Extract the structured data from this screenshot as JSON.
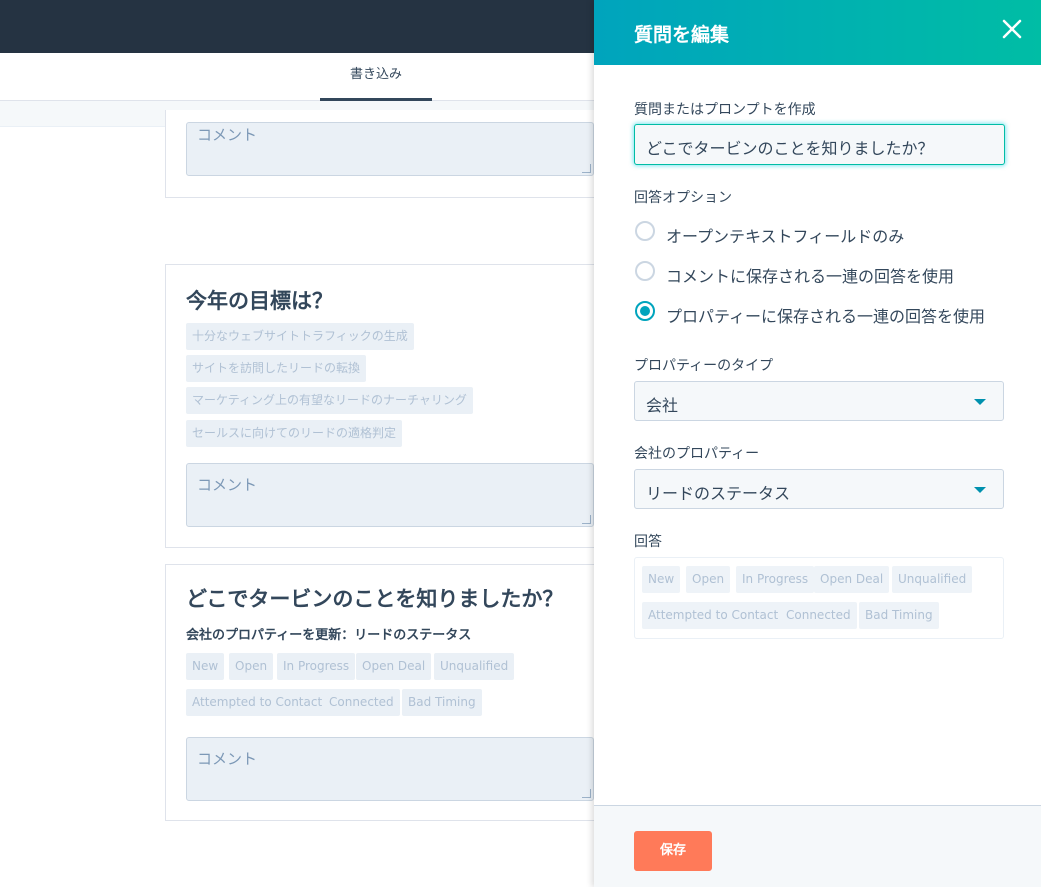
{
  "header": {
    "tab_label": "書き込み"
  },
  "cards": {
    "card1": {
      "comment_placeholder": "コメント"
    },
    "card2": {
      "title": "今年の目標は？",
      "options": [
        "十分なウェブサイトトラフィックの生成",
        "サイトを訪問したリードの転換",
        "マーケティング上の有望なリードのナーチャリング",
        "セールスに向けてのリードの適格判定"
      ],
      "comment_placeholder": "コメント"
    },
    "card3": {
      "title": "どこでタービンのことを知りましたか？",
      "subtitle": "会社のプロパティーを更新：リードのステータス",
      "options": [
        "New",
        "Open",
        "In Progress",
        "Open Deal",
        "Unqualified",
        "Attempted to Contact",
        "Connected",
        "Bad Timing"
      ],
      "comment_placeholder": "コメント"
    }
  },
  "panel": {
    "title": "質問を編集",
    "question_label": "質問またはプロンプトを作成",
    "question_value": "どこでタービンのことを知りましたか？",
    "answer_options_label": "回答オプション",
    "radio_options": [
      {
        "label": "オープンテキストフィールドのみ",
        "selected": false
      },
      {
        "label": "コメントに保存される一連の回答を使用",
        "selected": false
      },
      {
        "label": "プロパティーに保存される一連の回答を使用",
        "selected": true
      }
    ],
    "property_type_label": "プロパティーのタイプ",
    "property_type_value": "会社",
    "company_property_label": "会社のプロパティー",
    "company_property_value": "リードのステータス",
    "answers_label": "回答",
    "answers": [
      "New",
      "Open",
      "In Progress",
      "Open Deal",
      "Unqualified",
      "Attempted to Contact",
      "Connected",
      "Bad Timing"
    ],
    "save_label": "保存"
  },
  "colors": {
    "header_bg": "#253342",
    "panel_accent": "#00a4bd",
    "panel_accent_2": "#00bda5",
    "save_button": "#ff7a59"
  },
  "icons": {
    "close": "close-icon",
    "dropdown": "chevron-down-icon"
  }
}
